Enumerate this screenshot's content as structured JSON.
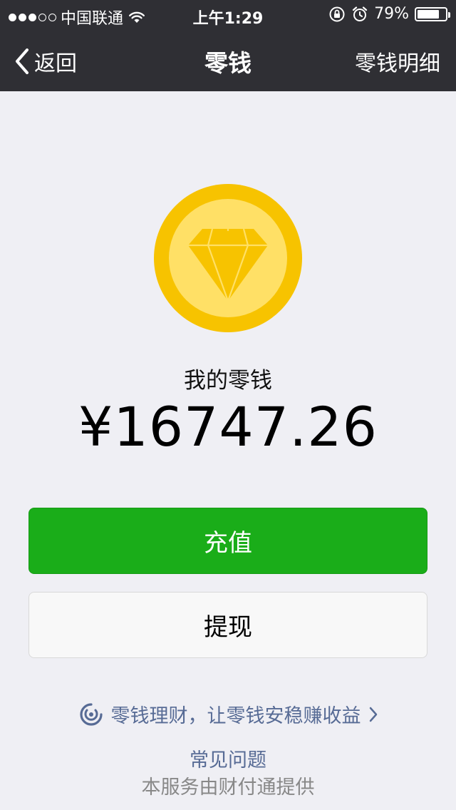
{
  "status_bar": {
    "carrier": "中国联通",
    "time": "上午1:29",
    "battery_percent_text": "79%",
    "battery_level": 0.79,
    "signal_strength": 3,
    "signal_max": 5
  },
  "nav": {
    "back_label": "返回",
    "title": "零钱",
    "detail_label": "零钱明细"
  },
  "wallet": {
    "label": "我的零钱",
    "amount": "¥16747.26"
  },
  "actions": {
    "recharge_label": "充值",
    "withdraw_label": "提现"
  },
  "footer": {
    "promo_text": "零钱理财，让零钱安稳赚收益",
    "faq_text": "常见问题",
    "provider_text": "本服务由财付通提供"
  },
  "colors": {
    "nav_bg": "#2f2f34",
    "page_bg": "#efeff4",
    "primary_green": "#1aad19",
    "link_blue": "#576b95",
    "coin_outer": "#f7c300",
    "coin_inner": "#ffe066"
  },
  "icons": {
    "back": "chevron-left-icon",
    "wifi": "wifi-icon",
    "rotation_lock": "rotation-lock-icon",
    "alarm": "alarm-icon",
    "battery": "battery-icon",
    "coin": "diamond-coin-icon",
    "promo": "wealth-icon",
    "promo_arrow": "chevron-right-icon"
  }
}
